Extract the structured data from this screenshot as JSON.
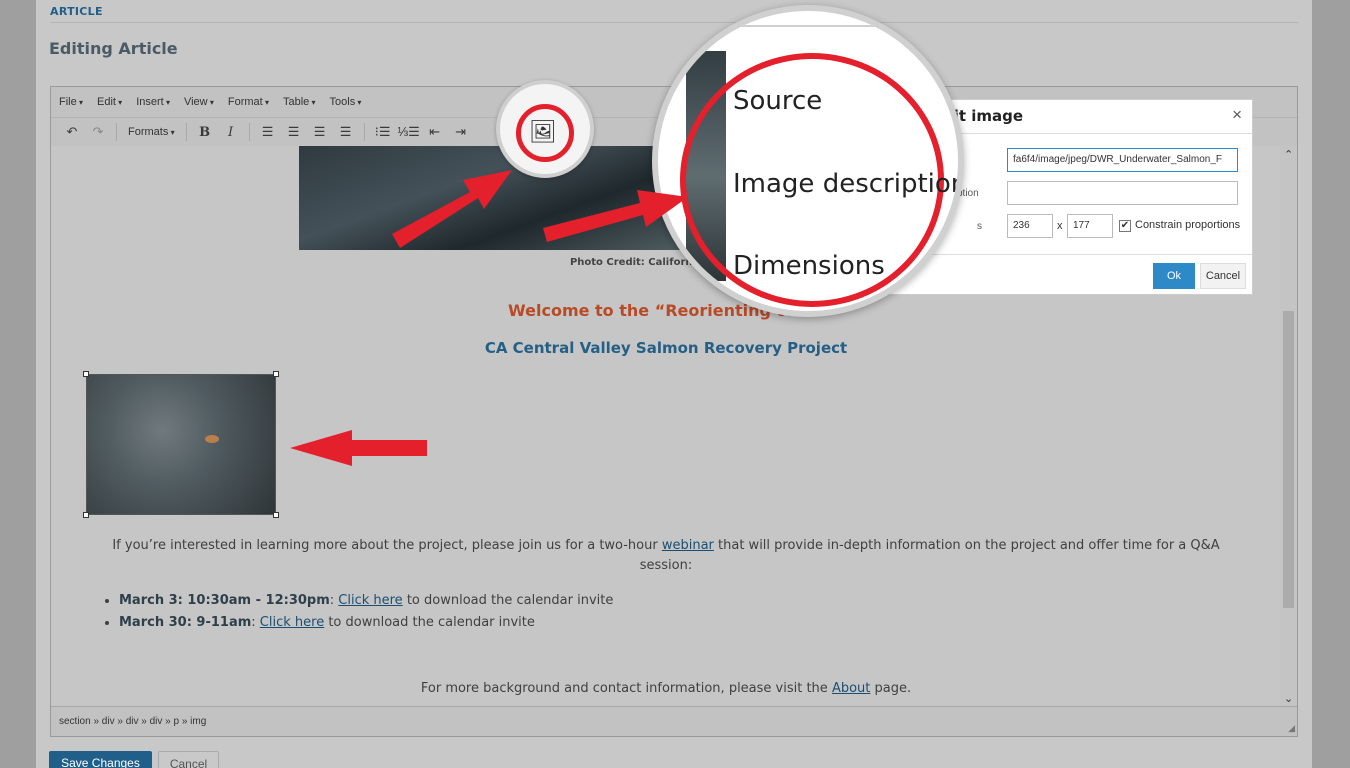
{
  "header": {
    "section_label": "ARTICLE",
    "page_title": "Editing Article"
  },
  "menubar": {
    "items": [
      "File",
      "Edit",
      "Insert",
      "View",
      "Format",
      "Table",
      "Tools"
    ]
  },
  "toolbar": {
    "formats_label": "Formats",
    "bold": "B",
    "italic": "I"
  },
  "content": {
    "photo_credit": "Photo Credit: California Departme",
    "welcome": "Welcome to the “Reorienting to Re",
    "subtitle": "CA Central Valley Salmon Recovery Project",
    "para_before": "If you’re interested in learning more about the project, please join us for a two-hour ",
    "para_link": "webinar",
    "para_after": " that will provide in-depth information on the project and offer time for a Q&A session:",
    "bullets": [
      {
        "date": "March 3: 10:30am - 12:30pm",
        "sep": ": ",
        "link": "Click here",
        "rest": " to download the calendar invite"
      },
      {
        "date": "March 30:  9-11am",
        "sep": ": ",
        "link": "Click here",
        "rest": " to download the calendar invite"
      }
    ],
    "footer_before": "For more background and contact information, please visit the ",
    "footer_link": "About",
    "footer_after": " page."
  },
  "statusbar": {
    "path": "section » div » div » div » p » img"
  },
  "buttons": {
    "save": "Save Changes",
    "cancel": "Cancel"
  },
  "dialog": {
    "title": "dit image",
    "source_value": "fa6f4/image/jpeg/DWR_Underwater_Salmon_F",
    "description_label": "ption",
    "description_value": "",
    "dimensions_label": "s",
    "width": "236",
    "x_sep": "x",
    "height": "177",
    "constrain_label": "Constrain proportions",
    "constrain_checked": "✔",
    "ok": "Ok",
    "cancel": "Cancel"
  },
  "magnifier": {
    "labels": [
      "Source",
      "Image description",
      "Dimensions"
    ]
  },
  "colors": {
    "accent": "#1f5f8a",
    "heading_orange": "#b84a25",
    "highlight_red": "#e3202c",
    "dialog_blue": "#2d8ac7"
  }
}
